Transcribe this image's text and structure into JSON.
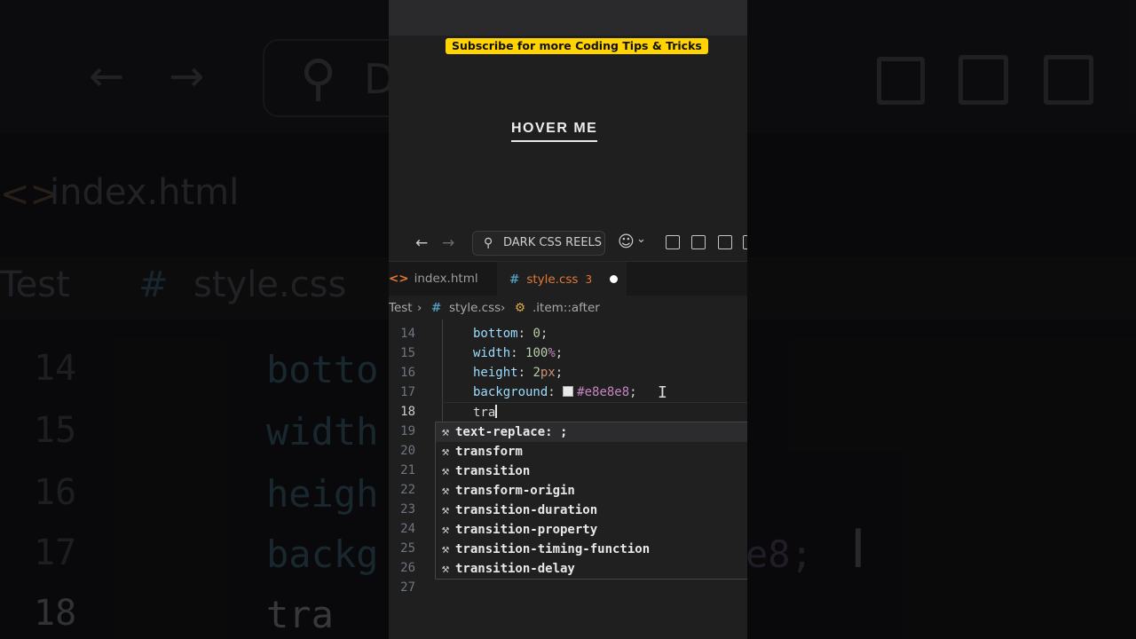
{
  "banner": "Subscribe for more Coding Tips & Tricks",
  "preview_button": "HOVER ME",
  "titlebar": {
    "back_glyph": "←",
    "forward_glyph": "→",
    "command_center": "DARK CSS REELS",
    "search_glyph": "⚲",
    "copilot_glyph": "☺",
    "chevron_glyph": "⌄"
  },
  "tabs": [
    {
      "icon": "<>",
      "label": "index.html"
    },
    {
      "icon": "#",
      "label": "style.css",
      "problems": "3",
      "modified": true
    }
  ],
  "breadcrumb": {
    "folder": "Test",
    "sep": "›",
    "file_hash": "#",
    "file": "style.css",
    "symbol_icon": "⚙",
    "symbol": ".item::after"
  },
  "editor": {
    "line_numbers": [
      "14",
      "15",
      "16",
      "17",
      "18",
      "19",
      "20",
      "21",
      "22",
      "23",
      "24",
      "25",
      "26",
      "27"
    ],
    "current_line": "18",
    "lines": {
      "l14_prop": "bottom",
      "l14_val": "0",
      "l15_prop": "width",
      "l15_num": "100",
      "l15_unit": "%",
      "l16_prop": "height",
      "l16_num": "2",
      "l16_unit": "px",
      "l17_prop": "background",
      "l17_val": "#e8e8e8",
      "l18_typed": "tra"
    }
  },
  "suggestions": [
    "text-replace: ;",
    "transform",
    "transition",
    "transform-origin",
    "transition-duration",
    "transition-property",
    "transition-timing-function",
    "transition-delay"
  ],
  "background_mirror": {
    "search_text": "D",
    "tab": "index.html",
    "crumb_folder": "Test",
    "crumb_file": "style.css",
    "lines": [
      "14",
      "15",
      "16",
      "17",
      "18"
    ],
    "code": [
      "botto",
      "width",
      "heigh",
      "backg",
      "tra"
    ],
    "tail": "e8;"
  },
  "colors": {
    "banner_bg": "#ffd400",
    "tab_active_text": "#e37933",
    "css_hash": "#519aba",
    "property": "#9cdcfe",
    "number": "#b5cea8",
    "hex": "#c586c0",
    "editor_bg": "#1f1f1f"
  }
}
